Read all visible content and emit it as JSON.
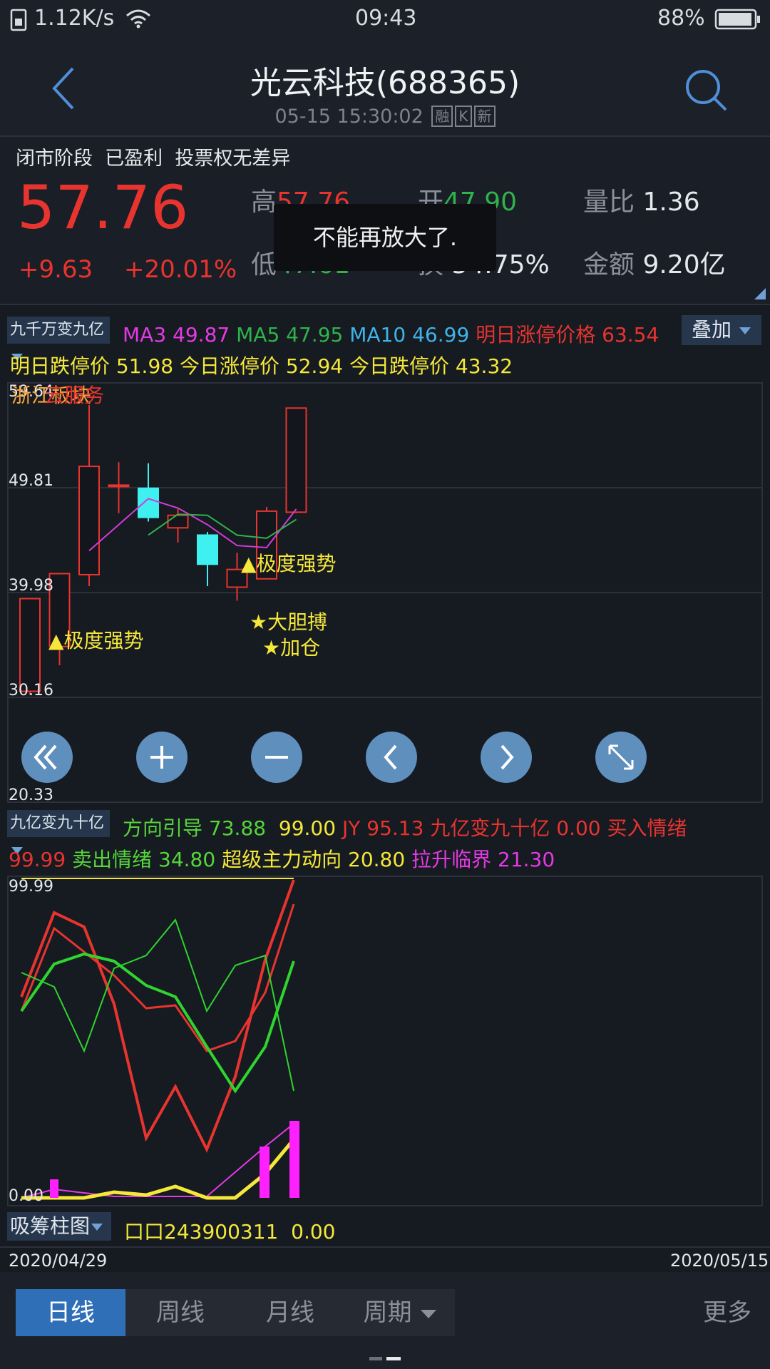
{
  "status_bar": {
    "net_speed": "1.12K/s",
    "time": "09:43",
    "battery": "88%"
  },
  "header": {
    "title": "光云科技(688365)",
    "subtitle": "05-15 15:30:02",
    "tags": [
      "融",
      "K",
      "新"
    ]
  },
  "quote": {
    "tags": "闭市阶段  已盈利  投票权无差异",
    "price": "57.76",
    "change": "+9.63",
    "change_pct": "+20.01%",
    "high_label": "高",
    "high": "57.76",
    "open_label": "开",
    "open": "47.90",
    "ratio_label": "量比",
    "ratio": "1.36",
    "low_label": "低",
    "low": "47.61",
    "turnover_label": "换",
    "turnover": "54.75%",
    "amount_label": "金额",
    "amount": "9.20亿"
  },
  "toast": "不能再放大了.",
  "ma_row": {
    "indicator": "九千万变九亿",
    "ma3_label": "MA3",
    "ma3": "49.87",
    "ma5_label": "MA5",
    "ma5": "47.95",
    "ma10_label": "MA10",
    "ma10": "46.99",
    "limit_up_tomorrow_label": "明日涨停价格",
    "limit_up_tomorrow": "63.54",
    "overlay_button": "叠加"
  },
  "limit_row": {
    "down_tomorrow_label": "明日跌停价",
    "down_tomorrow": "51.98",
    "up_today_label": "今日涨停价",
    "up_today": "52.94",
    "down_today_label": "今日跌停价",
    "down_today": "43.32"
  },
  "kline_overlay_text": "浙江板块",
  "kline_overlay_text2": "云服务",
  "kline_axis": [
    "59.64",
    "49.81",
    "39.98",
    "30.16",
    "20.33"
  ],
  "annotations": {
    "strong1": "▲极度强势",
    "strong2": "▲极度强势",
    "bold": "★大胆搏",
    "add": "★加仓"
  },
  "controls": [
    "rewind-icon",
    "zoom-in-icon",
    "zoom-out-icon",
    "left-icon",
    "right-icon",
    "fullscreen-icon"
  ],
  "ind2_row": {
    "indicator": "九亿变九十亿",
    "direction_label": "方向引导",
    "direction": "73.88",
    "v99": "99.00",
    "jy_label": "JY",
    "jy": "95.13",
    "name_label": "九亿变九十亿",
    "name_val": "0.00",
    "buy_label": "买入情绪"
  },
  "ind2_row2": {
    "buy_val": "99.99",
    "sell_label": "卖出情绪",
    "sell_val": "34.80",
    "super_label": "超级主力动向",
    "super_val": "20.80",
    "lift_label": "拉升临界",
    "lift_val": "21.30"
  },
  "ind2_axis": [
    "99.99",
    "0.00"
  ],
  "ind3_row": {
    "indicator": "吸筹柱图",
    "text": "口口243900311",
    "val": "0.00"
  },
  "date_range": {
    "start": "2020/04/29",
    "end": "2020/05/15"
  },
  "tabs": {
    "daily": "日线",
    "weekly": "周线",
    "monthly": "月线",
    "period": "周期",
    "more": "更多"
  },
  "colors": {
    "up": "#e8342f",
    "down": "#3ff0f0",
    "ma3": "#e43ae4",
    "ma5": "#2fb34b",
    "ma10": "#3fb4e8",
    "accent": "#2f6fb8"
  },
  "chart_data": {
    "type": "candlestick",
    "ylim": [
      20.33,
      59.64
    ],
    "candles": [
      {
        "o": 30.5,
        "h": 37.0,
        "l": 30.16,
        "c": 39.4
      },
      {
        "o": 34.8,
        "h": 38.2,
        "l": 33.0,
        "c": 41.8
      },
      {
        "o": 41.7,
        "h": 58.0,
        "l": 40.6,
        "c": 52.1
      },
      {
        "o": 50.3,
        "h": 52.5,
        "l": 47.6,
        "c": 50.3
      },
      {
        "o": 50.0,
        "h": 52.4,
        "l": 46.8,
        "c": 47.2
      },
      {
        "o": 46.2,
        "h": 48.0,
        "l": 44.8,
        "c": 47.4
      },
      {
        "o": 45.5,
        "h": 45.8,
        "l": 40.6,
        "c": 42.7
      },
      {
        "o": 40.5,
        "h": 43.8,
        "l": 39.2,
        "c": 42.2
      },
      {
        "o": 41.3,
        "h": 48.2,
        "l": 42.6,
        "c": 47.8
      },
      {
        "o": 47.7,
        "h": 57.2,
        "l": 47.6,
        "c": 57.7
      }
    ],
    "ma3": [
      null,
      null,
      44.0,
      46.5,
      49.0,
      48.1,
      46.5,
      44.5,
      44.3,
      48.0
    ],
    "ma5": [
      null,
      null,
      null,
      null,
      45.5,
      47.5,
      47.4,
      45.5,
      45.2,
      47.0
    ]
  }
}
